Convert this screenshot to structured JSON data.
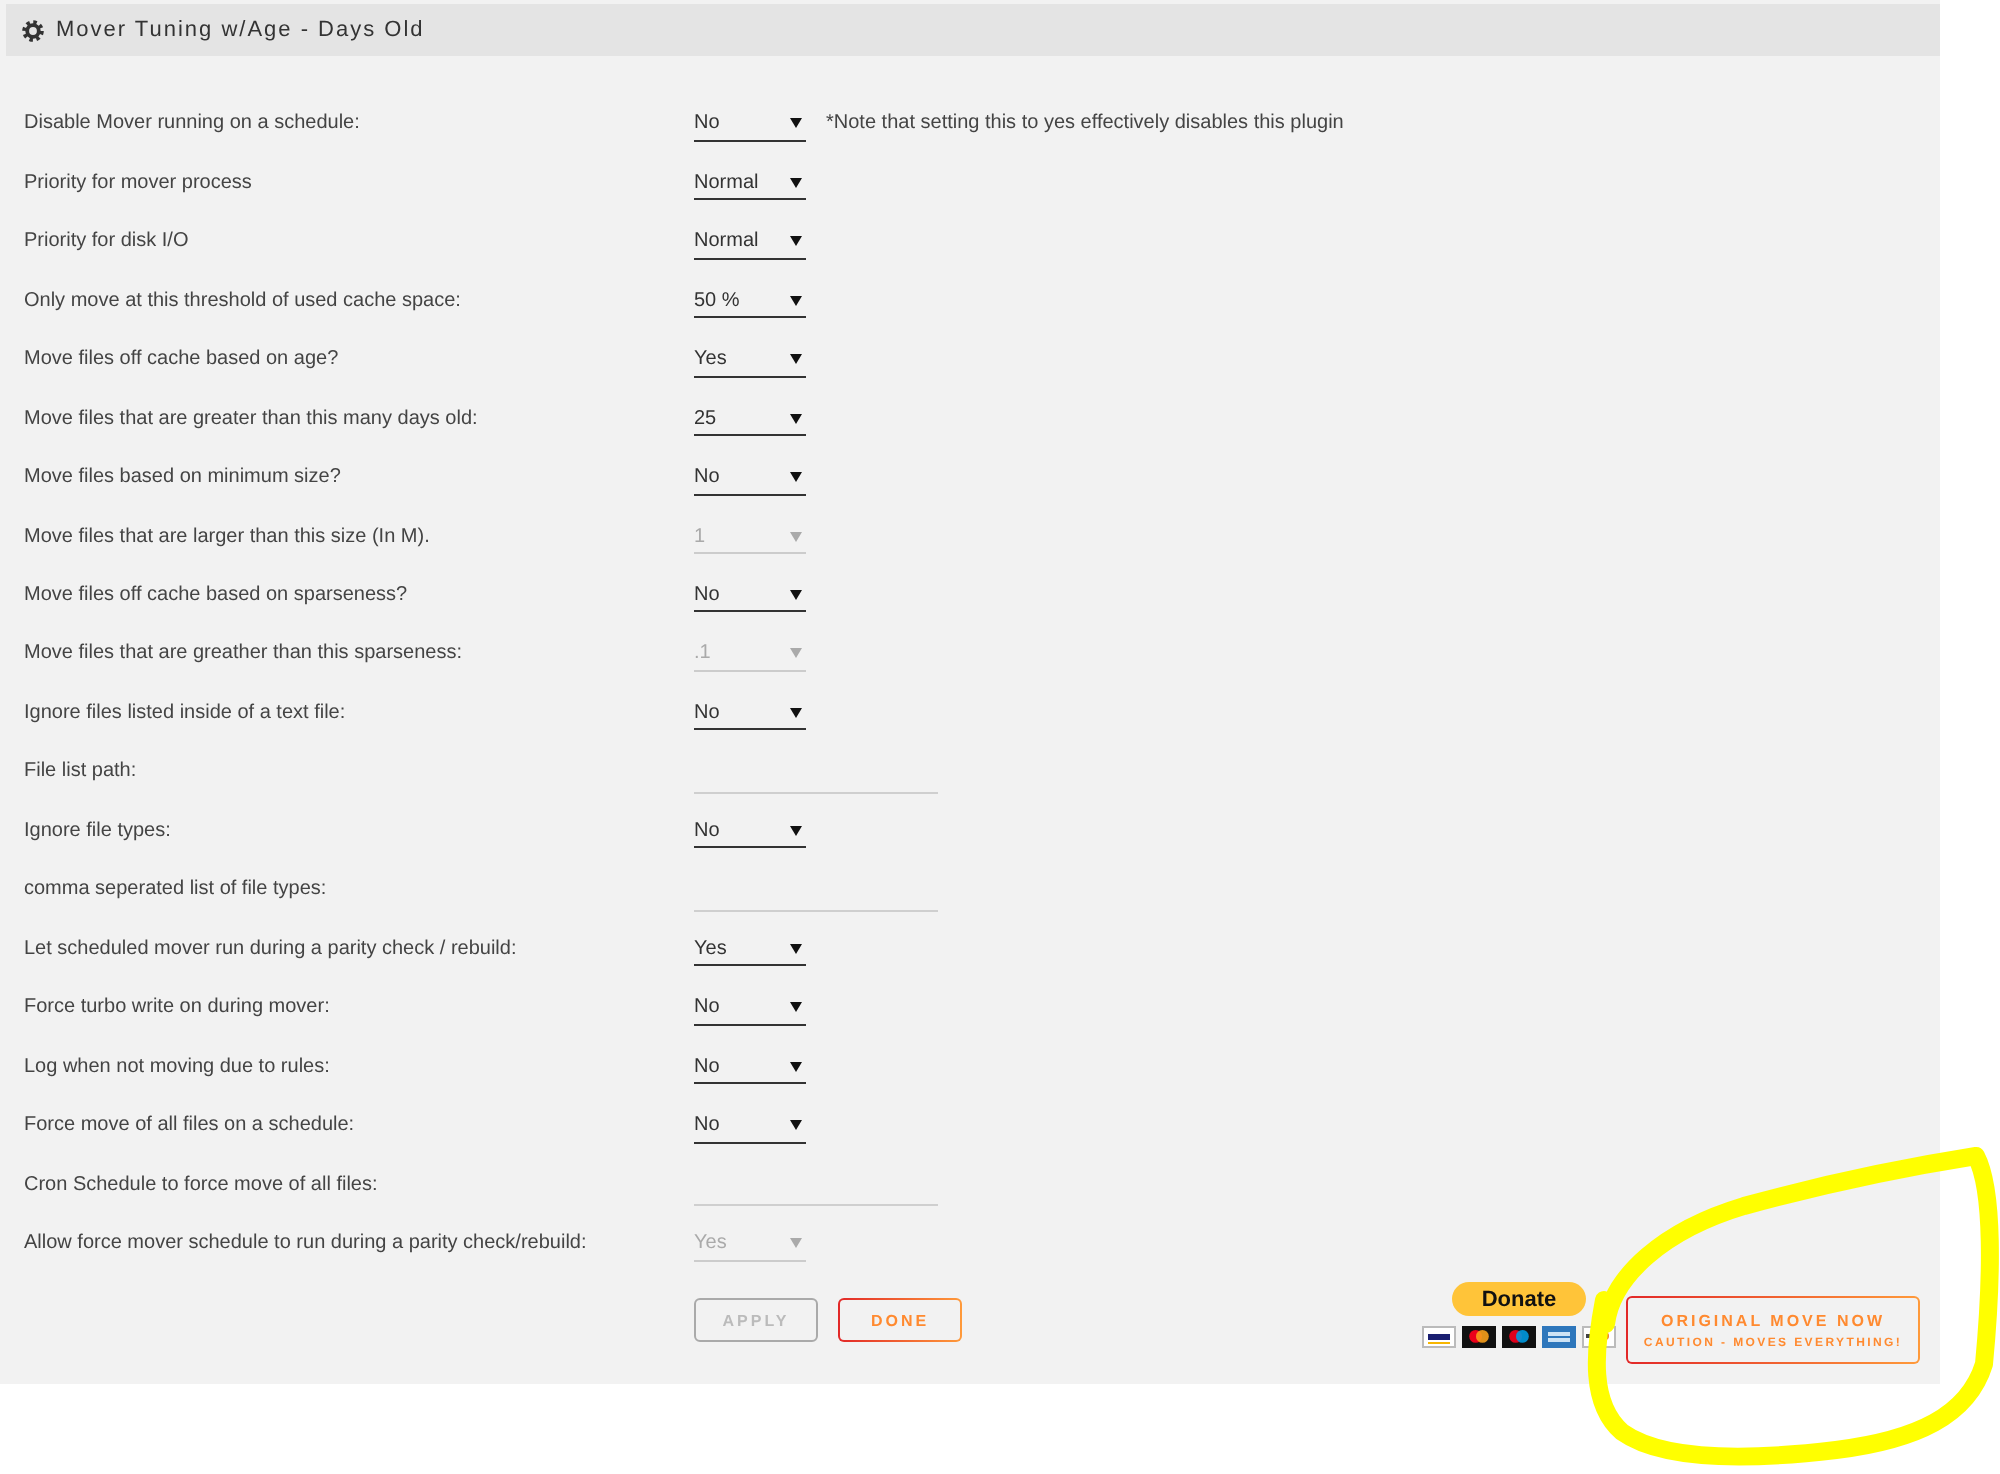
{
  "panel": {
    "title": "Mover Tuning w/Age - Days Old"
  },
  "settings": [
    {
      "label": "Disable Mover running on a schedule:",
      "kind": "select",
      "value": "No",
      "disabled": false,
      "note": "*Note that setting this to yes effectively disables this plugin"
    },
    {
      "label": "Priority for mover process",
      "kind": "select",
      "value": "Normal",
      "disabled": false
    },
    {
      "label": "Priority for disk I/O",
      "kind": "select",
      "value": "Normal",
      "disabled": false
    },
    {
      "label": "Only move at this threshold of used cache space:",
      "kind": "select",
      "value": "50 %",
      "disabled": false
    },
    {
      "label": "Move files off cache based on age?",
      "kind": "select",
      "value": "Yes",
      "disabled": false
    },
    {
      "label": "Move files that are greater than this many days old:",
      "kind": "select",
      "value": "25",
      "disabled": false
    },
    {
      "label": "Move files based on minimum size?",
      "kind": "select",
      "value": "No",
      "disabled": false
    },
    {
      "label": "Move files that are larger than this size (In M).",
      "kind": "select",
      "value": "1",
      "disabled": true
    },
    {
      "label": "Move files off cache based on sparseness?",
      "kind": "select",
      "value": "No",
      "disabled": false
    },
    {
      "label": "Move files that are greather than this sparseness:",
      "kind": "select",
      "value": ".1",
      "disabled": true
    },
    {
      "label": "Ignore files listed inside of a text file:",
      "kind": "select",
      "value": "No",
      "disabled": false
    },
    {
      "label": "File list path:",
      "kind": "text"
    },
    {
      "label": "Ignore file types:",
      "kind": "select",
      "value": "No",
      "disabled": false
    },
    {
      "label": "comma seperated list of file types:",
      "kind": "text"
    },
    {
      "label": "Let scheduled mover run during a parity check / rebuild:",
      "kind": "select",
      "value": "Yes",
      "disabled": false
    },
    {
      "label": "Force turbo write on during mover:",
      "kind": "select",
      "value": "No",
      "disabled": false
    },
    {
      "label": "Log when not moving due to rules:",
      "kind": "select",
      "value": "No",
      "disabled": false
    },
    {
      "label": "Force move of all files on a schedule:",
      "kind": "select",
      "value": "No",
      "disabled": false
    },
    {
      "label": "Cron Schedule to force move of all files:",
      "kind": "text"
    },
    {
      "label": "Allow force mover schedule to run during a parity check/rebuild:",
      "kind": "select",
      "value": "Yes",
      "disabled": true
    }
  ],
  "buttons": [
    {
      "label": "APPLY",
      "disabled": true
    },
    {
      "label": "DONE",
      "disabled": false
    }
  ],
  "donate": {
    "label": "Donate"
  },
  "move_now": {
    "label": "ORIGINAL MOVE NOW",
    "caution": "CAUTION - MOVES EVERYTHING!"
  }
}
